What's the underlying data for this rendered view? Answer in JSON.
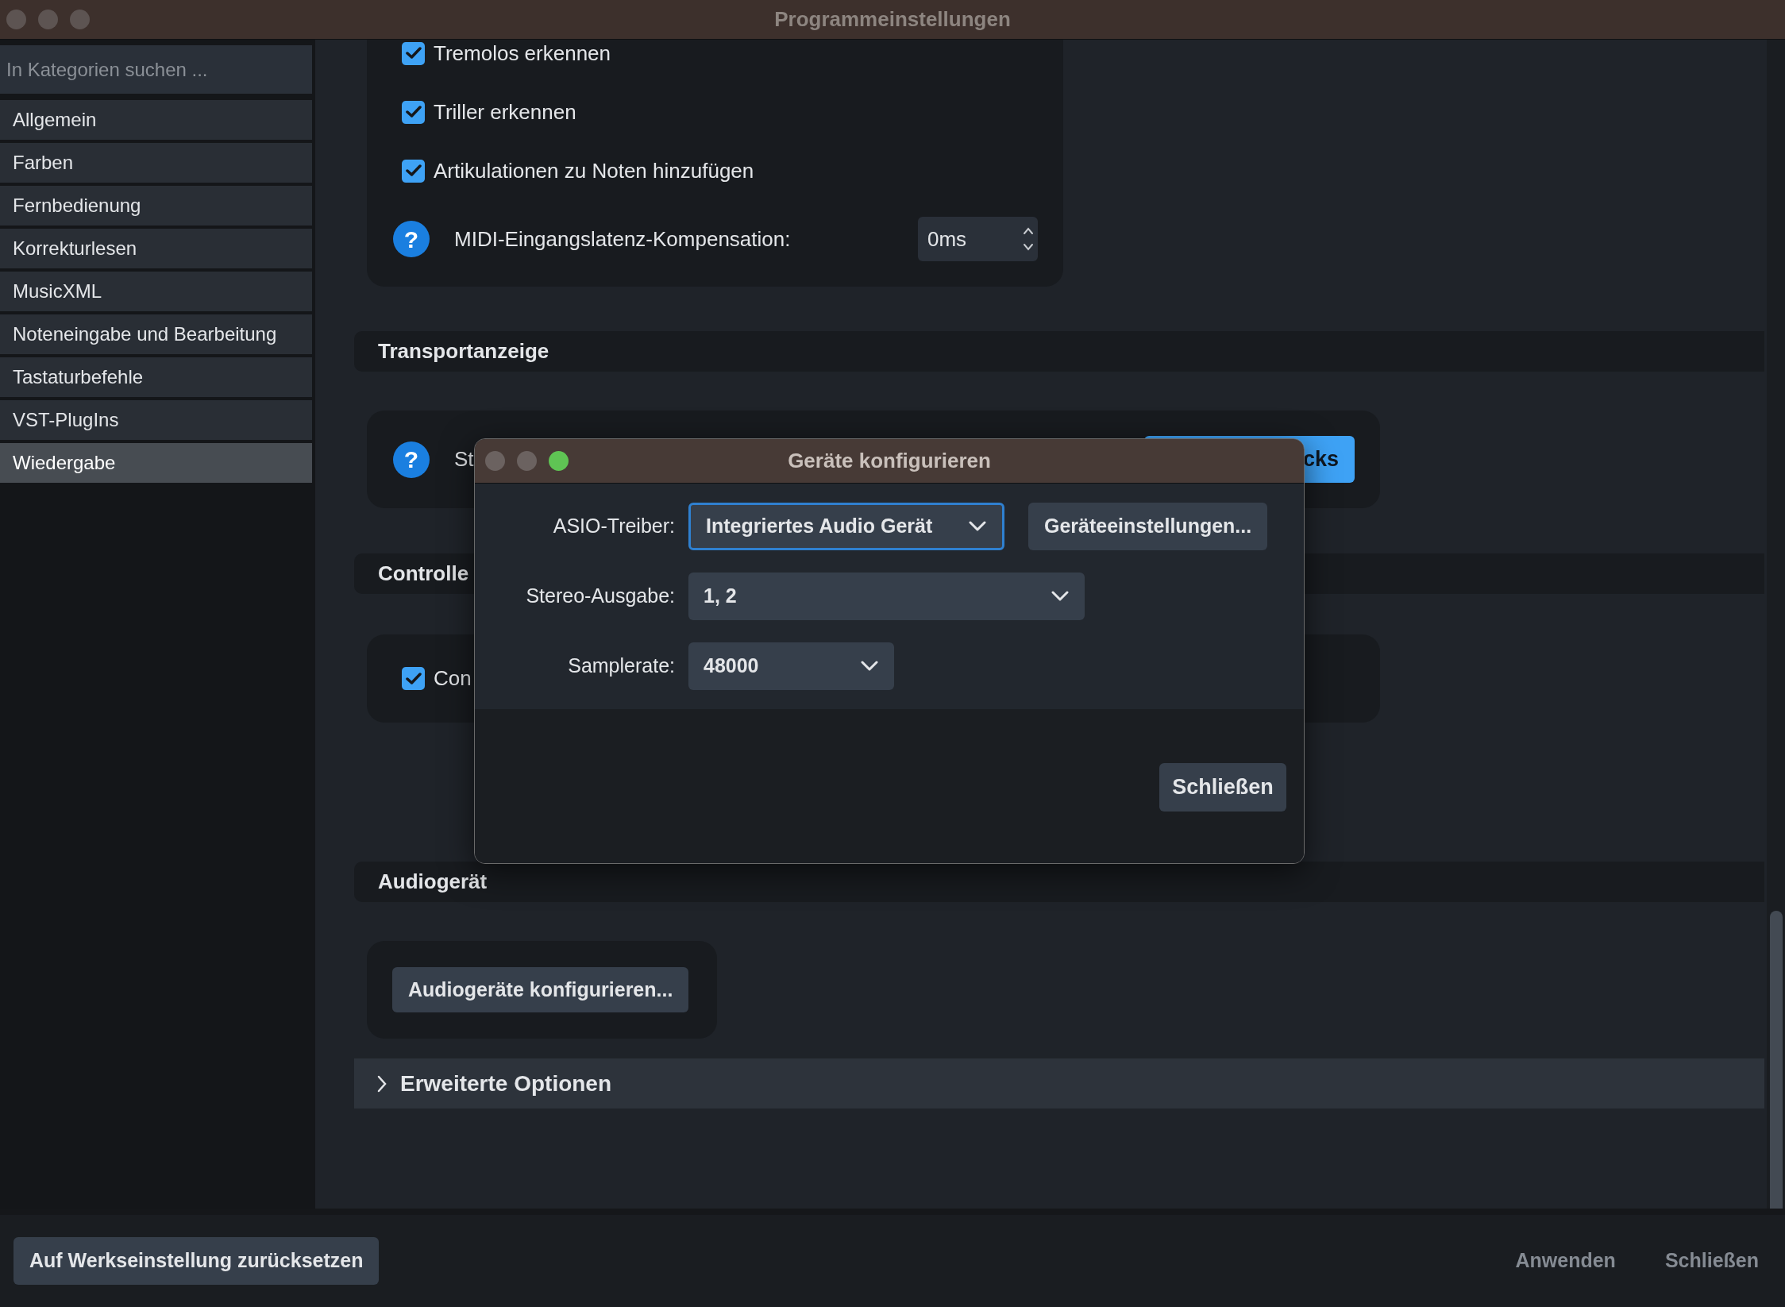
{
  "window": {
    "title": "Programmeinstellungen"
  },
  "sidebar": {
    "search": {
      "placeholder": "In Kategorien suchen ..."
    },
    "items": [
      {
        "label": "Allgemein",
        "selected": false
      },
      {
        "label": "Farben",
        "selected": false
      },
      {
        "label": "Fernbedienung",
        "selected": false
      },
      {
        "label": "Korrekturlesen",
        "selected": false
      },
      {
        "label": "MusicXML",
        "selected": false
      },
      {
        "label": "Noteneingabe und Bearbeitung",
        "selected": false
      },
      {
        "label": "Tastaturbefehle",
        "selected": false
      },
      {
        "label": "VST-PlugIns",
        "selected": false
      },
      {
        "label": "Wiedergabe",
        "selected": true
      }
    ]
  },
  "midi_input": {
    "checkboxes": [
      {
        "label": "Tremolos erkennen",
        "checked": true
      },
      {
        "label": "Triller erkennen",
        "checked": true
      },
      {
        "label": "Artikulationen zu Noten hinzufügen",
        "checked": true
      }
    ],
    "latency": {
      "help_icon": "?",
      "label": "MIDI-Eingangslatenz-Kompensation:",
      "value": "0ms"
    }
  },
  "transport": {
    "title": "Transportanzeige",
    "help_icon": "?",
    "label": "St",
    "button": "cks"
  },
  "controller": {
    "title": "Controlle",
    "checkbox": {
      "label": "Con",
      "checked": true
    }
  },
  "audio": {
    "title": "Audiogerät",
    "button": "Audiogeräte konfigurieren..."
  },
  "advanced": {
    "title": "Erweiterte Optionen",
    "expanded": false
  },
  "footer": {
    "reset": "Auf Werkseinstellung zurücksetzen",
    "apply": {
      "label": "Anwenden",
      "disabled": true
    },
    "close": {
      "label": "Schließen",
      "disabled": true
    }
  },
  "dialog": {
    "title": "Geräte konfigurieren",
    "fields": [
      {
        "label": "ASIO-Treiber:",
        "value": "Integriertes Audio Gerät",
        "focused": true
      },
      {
        "label": "Stereo-Ausgabe:",
        "value": "1, 2",
        "focused": false
      },
      {
        "label": "Samplerate:",
        "value": "48000",
        "focused": false
      }
    ],
    "device_settings_button": "Geräteeinstellungen...",
    "close_button": "Schließen"
  }
}
